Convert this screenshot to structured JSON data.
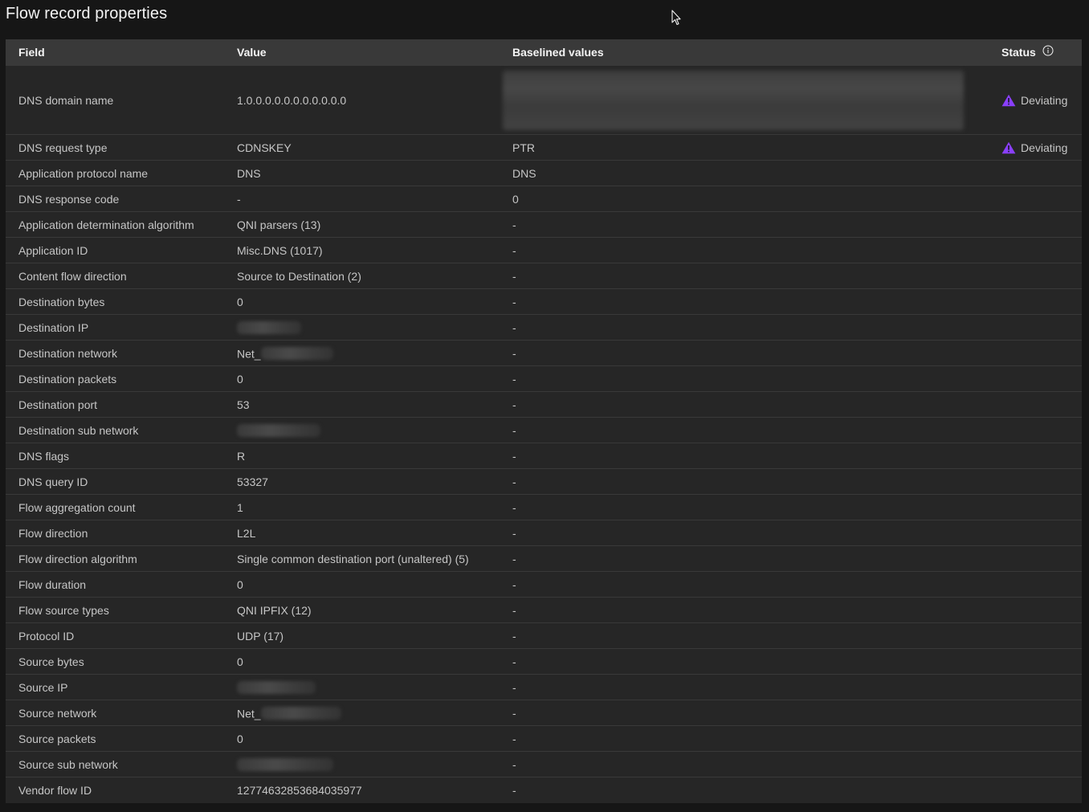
{
  "page": {
    "title": "Flow record properties"
  },
  "table": {
    "headers": {
      "field": "Field",
      "value": "Value",
      "baselined": "Baselined values",
      "status": "Status"
    },
    "rows": [
      {
        "field": "DNS domain name",
        "value": "1.0.0.0.0.0.0.0.0.0.0.0",
        "baselined": "",
        "status": "Deviating"
      },
      {
        "field": "DNS request type",
        "value": "CDNSKEY",
        "baselined": "PTR",
        "status": "Deviating"
      },
      {
        "field": "Application protocol name",
        "value": "DNS",
        "baselined": "DNS",
        "status": ""
      },
      {
        "field": "DNS response code",
        "value": "-",
        "baselined": "0",
        "status": ""
      },
      {
        "field": "Application determination algorithm",
        "value": "QNI parsers (13)",
        "baselined": "-",
        "status": ""
      },
      {
        "field": "Application ID",
        "value": "Misc.DNS (1017)",
        "baselined": "-",
        "status": ""
      },
      {
        "field": "Content flow direction",
        "value": "Source to Destination (2)",
        "baselined": "-",
        "status": ""
      },
      {
        "field": "Destination bytes",
        "value": "0",
        "baselined": "-",
        "status": ""
      },
      {
        "field": "Destination IP",
        "value": "",
        "baselined": "-",
        "status": ""
      },
      {
        "field": "Destination network",
        "value": "Net_",
        "baselined": "-",
        "status": ""
      },
      {
        "field": "Destination packets",
        "value": "0",
        "baselined": "-",
        "status": ""
      },
      {
        "field": "Destination port",
        "value": "53",
        "baselined": "-",
        "status": ""
      },
      {
        "field": "Destination sub network",
        "value": "",
        "baselined": "-",
        "status": ""
      },
      {
        "field": "DNS flags",
        "value": "R",
        "baselined": "-",
        "status": ""
      },
      {
        "field": "DNS query ID",
        "value": "53327",
        "baselined": "-",
        "status": ""
      },
      {
        "field": "Flow aggregation count",
        "value": "1",
        "baselined": "-",
        "status": ""
      },
      {
        "field": "Flow direction",
        "value": "L2L",
        "baselined": "-",
        "status": ""
      },
      {
        "field": "Flow direction algorithm",
        "value": "Single common destination port (unaltered) (5)",
        "baselined": "-",
        "status": ""
      },
      {
        "field": "Flow duration",
        "value": "0",
        "baselined": "-",
        "status": ""
      },
      {
        "field": "Flow source types",
        "value": "QNI IPFIX (12)",
        "baselined": "-",
        "status": ""
      },
      {
        "field": "Protocol ID",
        "value": "UDP (17)",
        "baselined": "-",
        "status": ""
      },
      {
        "field": "Source bytes",
        "value": "0",
        "baselined": "-",
        "status": ""
      },
      {
        "field": "Source IP",
        "value": "",
        "baselined": "-",
        "status": ""
      },
      {
        "field": "Source network",
        "value": "Net_",
        "baselined": "-",
        "status": ""
      },
      {
        "field": "Source packets",
        "value": "0",
        "baselined": "-",
        "status": ""
      },
      {
        "field": "Source sub network",
        "value": "",
        "baselined": "-",
        "status": ""
      },
      {
        "field": "Vendor flow ID",
        "value": "12774632853684035977",
        "baselined": "-",
        "status": ""
      }
    ]
  },
  "icons": {
    "status_info": "info-icon",
    "deviating": "warning-icon",
    "cursor": "mouse-pointer-icon"
  },
  "colors": {
    "background": "#161616",
    "table_body": "#262626",
    "header_row": "#393939",
    "warning": "#8a3ffc"
  }
}
